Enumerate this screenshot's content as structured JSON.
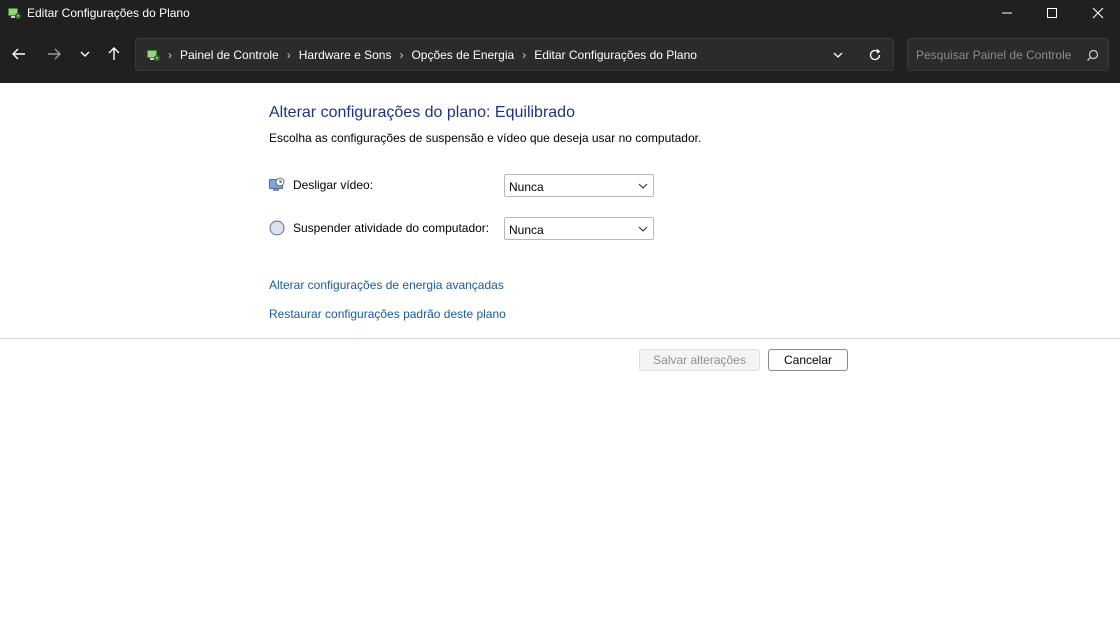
{
  "window": {
    "title": "Editar Configurações do Plano"
  },
  "nav": {
    "breadcrumbs": [
      "Painel de Controle",
      "Hardware e Sons",
      "Opções de Energia",
      "Editar Configurações do Plano"
    ],
    "search_placeholder": "Pesquisar Painel de Controle"
  },
  "main": {
    "heading": "Alterar configurações do plano: Equilibrado",
    "subtitle": "Escolha as configurações de suspensão e vídeo que deseja usar no computador.",
    "settings": [
      {
        "label": "Desligar vídeo:",
        "value": "Nunca",
        "icon": "monitor-clock-icon"
      },
      {
        "label": "Suspender atividade do computador:",
        "value": "Nunca",
        "icon": "moon-sleep-icon"
      }
    ],
    "links": [
      "Alterar configurações de energia avançadas",
      "Restaurar configurações padrão deste plano"
    ]
  },
  "buttons": {
    "save_label": "Salvar alterações",
    "cancel_label": "Cancelar"
  },
  "colors": {
    "titlebar_bg": "#202020",
    "heading": "#1e3287",
    "link": "#1a5aa8"
  }
}
